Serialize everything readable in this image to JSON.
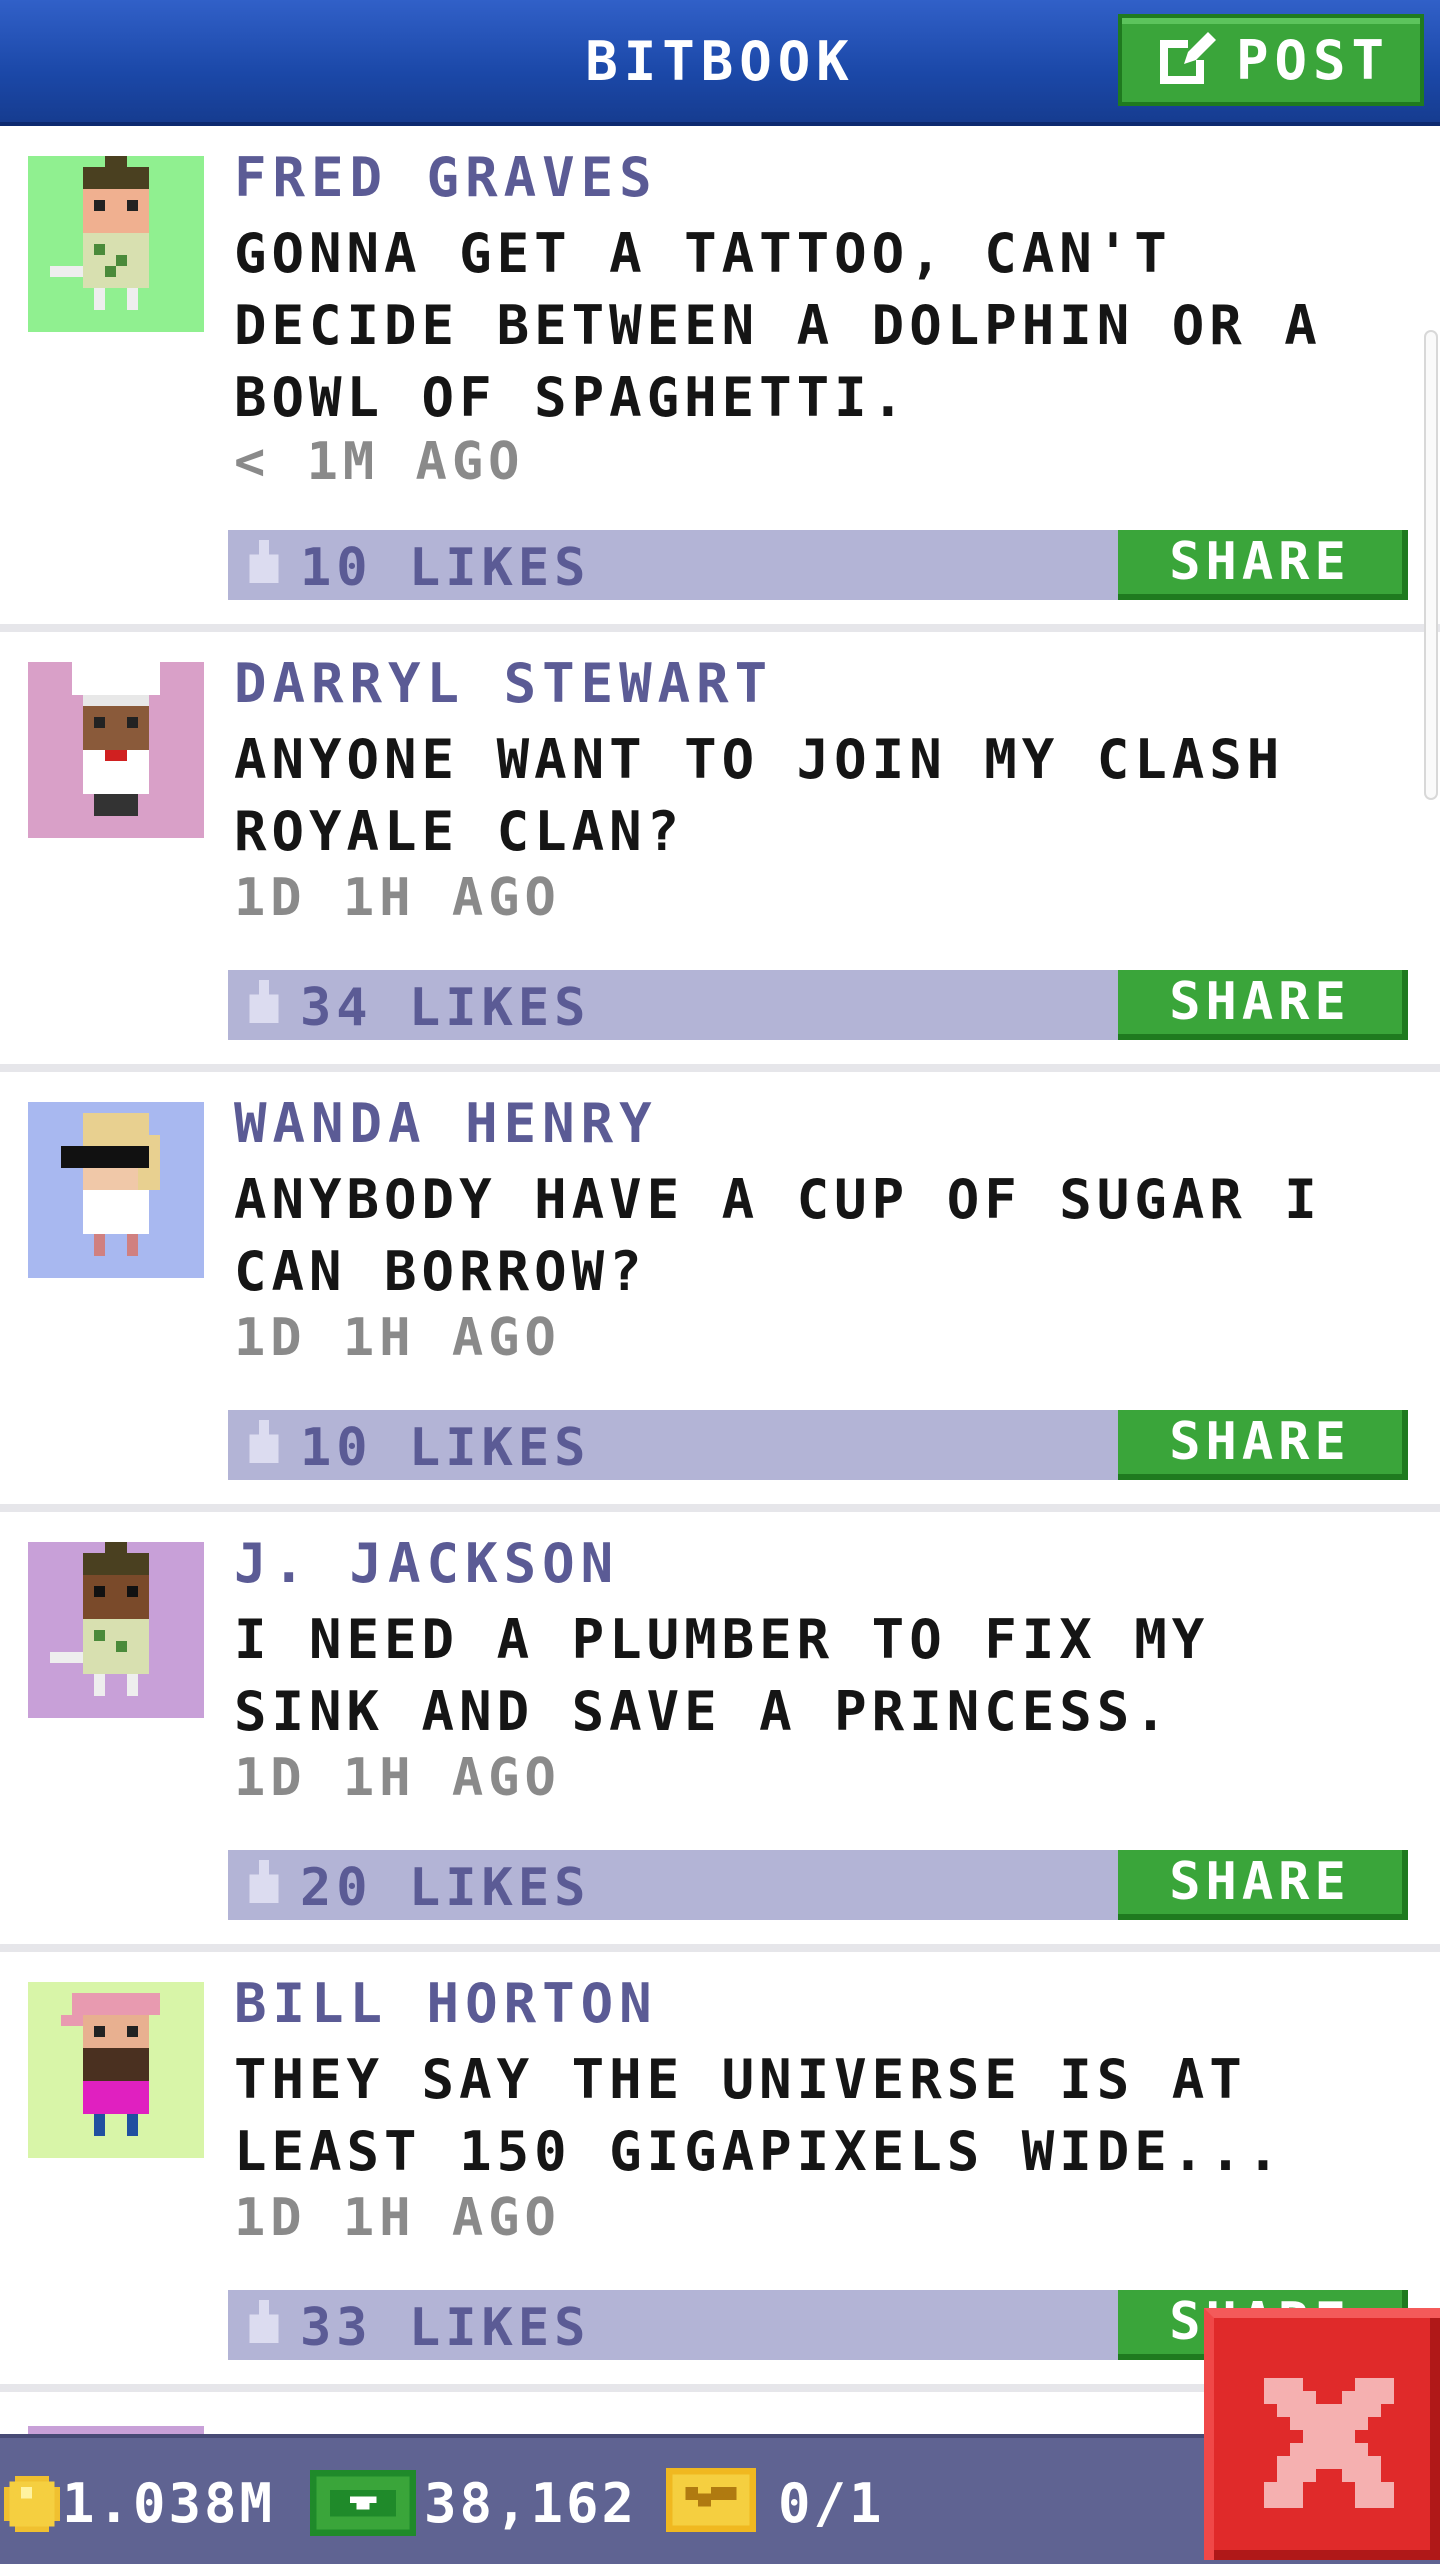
{
  "header": {
    "title": "BITBOOK",
    "post_label": "POST"
  },
  "posts": [
    {
      "name": "FRED GRAVES",
      "text": "GONNA GET A TATTOO, CAN'T DECIDE BETWEEN A DOLPHIN OR A BOWL OF SPAGHETTI.",
      "time": "< 1M AGO",
      "likes": "10 LIKES",
      "share": "SHARE",
      "avatar_bg": "#90f090"
    },
    {
      "name": "DARRYL STEWART",
      "text": "ANYONE WANT TO JOIN MY CLASH ROYALE CLAN?",
      "time": "1D 1H AGO",
      "likes": "34 LIKES",
      "share": "SHARE",
      "avatar_bg": "#d9a0c8"
    },
    {
      "name": "WANDA HENRY",
      "text": "ANYBODY HAVE A CUP OF SUGAR I CAN BORROW?",
      "time": "1D 1H AGO",
      "likes": "10 LIKES",
      "share": "SHARE",
      "avatar_bg": "#a8b8f0"
    },
    {
      "name": "J. JACKSON",
      "text": "I NEED A PLUMBER TO FIX MY SINK AND SAVE A PRINCESS.",
      "time": "1D 1H AGO",
      "likes": "20 LIKES",
      "share": "SHARE",
      "avatar_bg": "#c8a0d8"
    },
    {
      "name": "BILL HORTON",
      "text": "THEY SAY THE UNIVERSE IS AT LEAST 150 GIGAPIXELS WIDE...",
      "time": "1D 1H AGO",
      "likes": "33 LIKES",
      "share": "SHARE",
      "avatar_bg": "#d8f5a8"
    }
  ],
  "status": {
    "coins": "1.038M",
    "bux": "38,162",
    "vip": "0/1"
  },
  "colors": {
    "header": "#1b48a8",
    "green": "#3aa53a",
    "likebar": "#b3b4d6",
    "name": "#5b5b95",
    "close": "#e02a2a",
    "statusbar": "#5f6392"
  }
}
